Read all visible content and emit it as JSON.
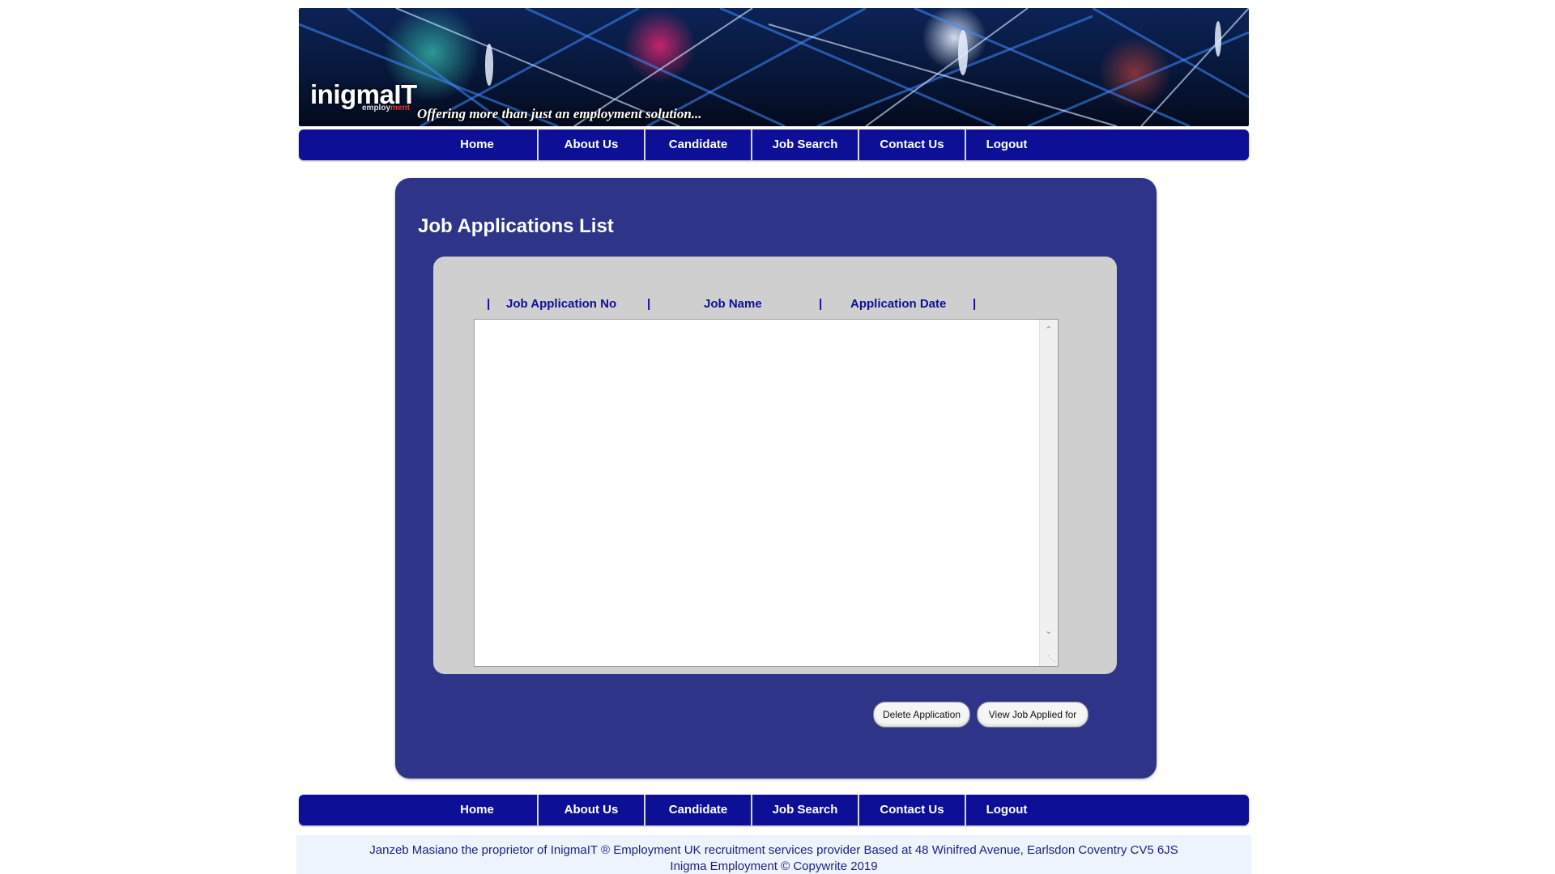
{
  "banner": {
    "logo_text": "inigmaIT",
    "logo_sub": "employ",
    "logo_sub2": "ment",
    "tagline": "Offering more than just an employment solution..."
  },
  "nav_top": {
    "items": [
      "Home",
      "About Us",
      "Candidate",
      "Job Search",
      "Contact Us",
      "Logout"
    ]
  },
  "nav_bottom": {
    "items": [
      "Home",
      "About Us",
      "Candidate",
      "Job Search",
      "Contact Us",
      "Logout"
    ]
  },
  "main": {
    "title": "Job Applications List",
    "columns": [
      "Job Application No",
      "Job Name",
      "Application Date"
    ],
    "column_separator": "|",
    "rows": [],
    "buttons": {
      "delete": "Delete Application",
      "view": "View Job Applied for"
    }
  },
  "footer": {
    "line1": "Janzeb Masiano the proprietor of InigmaIT ® Employment UK recruitment services provider Based at 48 Winifred Avenue, Earlsdon Coventry CV5 6JS",
    "line2": "Inigma Employment © Copywrite 2019"
  },
  "colors": {
    "nav_bg": "#0d0f96",
    "panel_bg": "#2e3488",
    "list_box_bg": "#cfcfcf",
    "header_text": "#0d0f96"
  }
}
